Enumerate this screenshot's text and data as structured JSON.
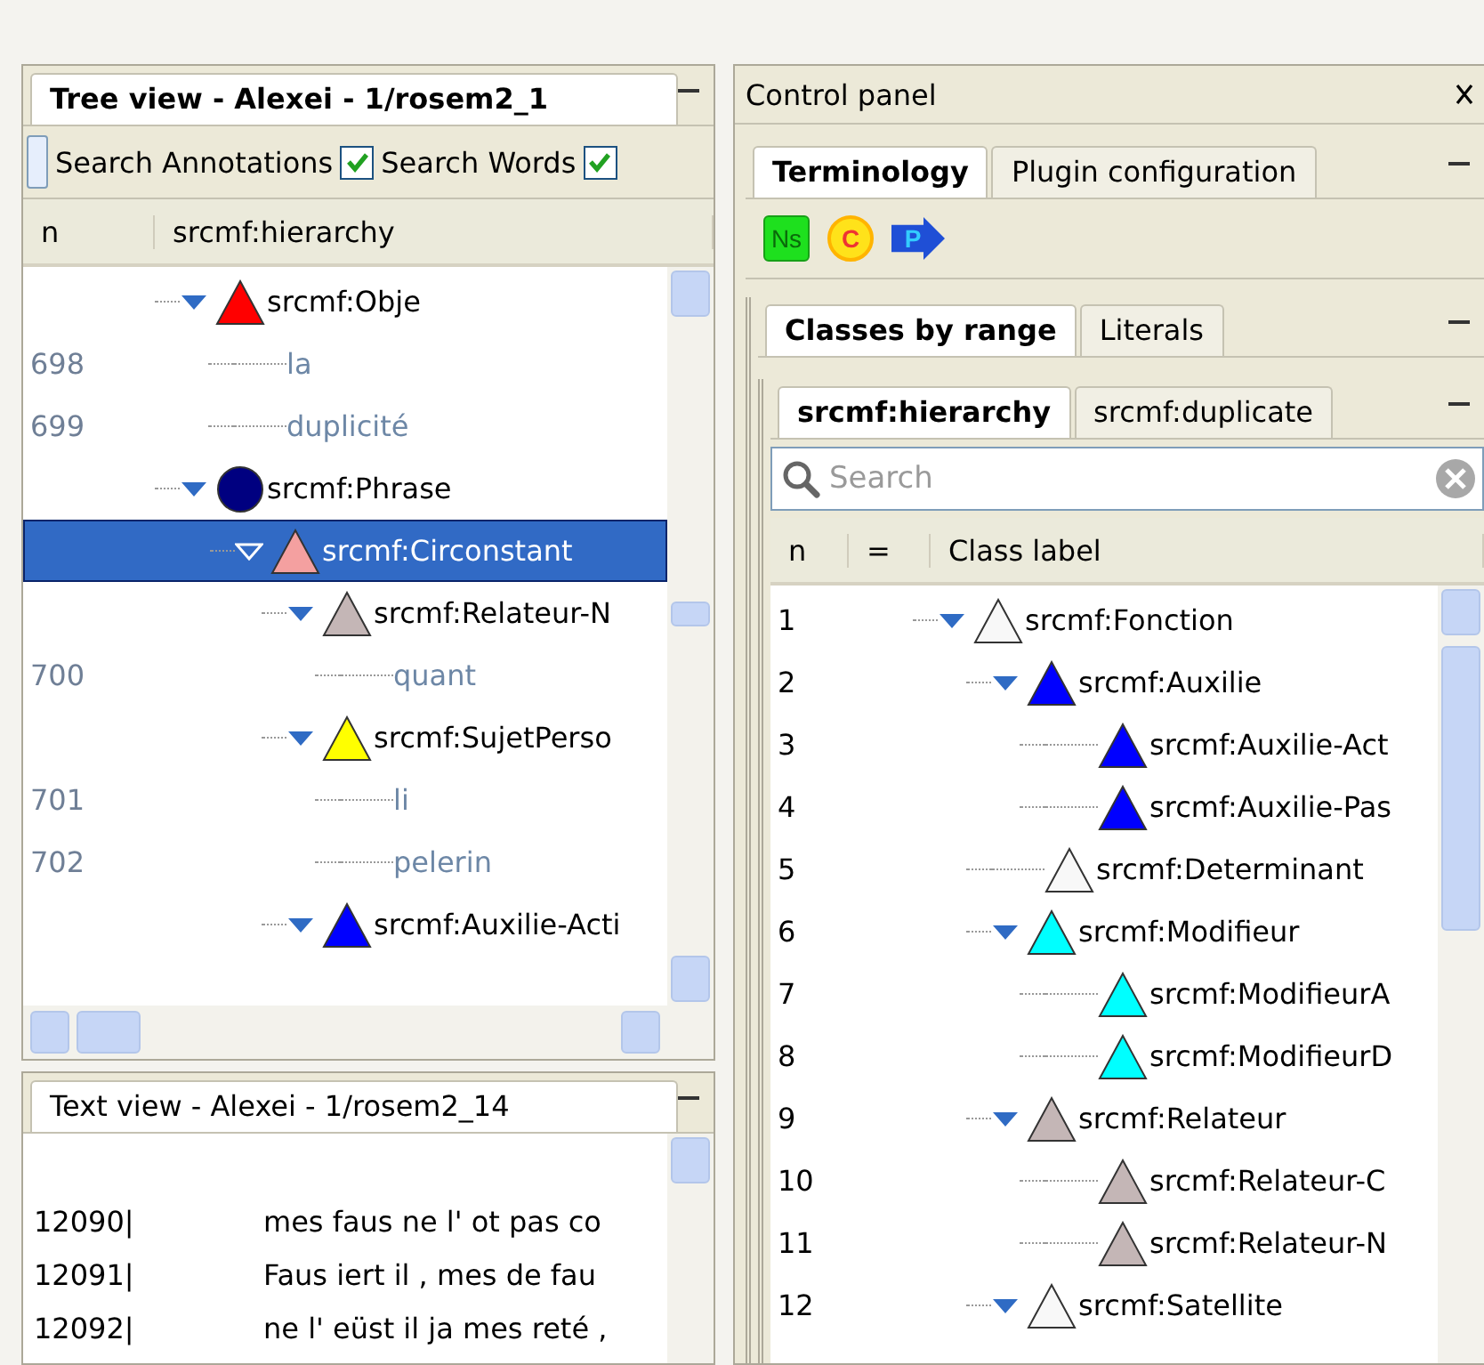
{
  "tree_view": {
    "title": "Tree view - Alexei - 1/rosem2_1",
    "toolbar": [
      {
        "label": "Search Annotations",
        "checked": true
      },
      {
        "label": "Search Words",
        "checked": true
      }
    ],
    "columns": [
      "n",
      "srcmf:hierarchy"
    ],
    "rows": [
      {
        "kind": "triangle",
        "label": "srcmf:Obje",
        "color": "#ff0000",
        "expanded": true,
        "selected": false,
        "children": [
          {
            "kind": "word",
            "n": "698",
            "label": "la",
            "selected": false
          },
          {
            "kind": "word",
            "n": "699",
            "label": "duplicité",
            "selected": false
          }
        ]
      },
      {
        "kind": "circle",
        "label": "srcmf:Phrase",
        "color": "#000080",
        "expanded": true,
        "selected": false,
        "children": [
          {
            "kind": "triangle",
            "label": "srcmf:Circonstant",
            "color": "#f4a0a0",
            "expanded": true,
            "selected": true,
            "children": [
              {
                "kind": "triangle",
                "label": "srcmf:Relateur-N",
                "color": "#c4b6b6",
                "expanded": true,
                "selected": false,
                "children": [
                  {
                    "kind": "word",
                    "n": "700",
                    "label": "quant",
                    "selected": false
                  }
                ]
              },
              {
                "kind": "triangle",
                "label": "srcmf:SujetPerso",
                "color": "#ffff00",
                "expanded": true,
                "selected": false,
                "children": [
                  {
                    "kind": "word",
                    "n": "701",
                    "label": "li",
                    "selected": false
                  },
                  {
                    "kind": "word",
                    "n": "702",
                    "label": "pelerin",
                    "selected": false
                  }
                ]
              },
              {
                "kind": "triangle",
                "label": "srcmf:Auxilie-Acti",
                "color": "#0000ff",
                "expanded": true,
                "selected": false
              }
            ]
          }
        ]
      }
    ]
  },
  "text_view": {
    "title": "Text view - Alexei - 1/rosem2_14",
    "lines": [
      {
        "n": "12090|",
        "text": "mes faus ne l' ot pas co"
      },
      {
        "n": "12091|",
        "text": "Faus iert il , mes de fau"
      },
      {
        "n": "12092|",
        "text": "ne l' eüst il ja mes reté ,"
      }
    ]
  },
  "control_panel": {
    "title": "Control panel",
    "tabs": [
      {
        "label": "Terminology",
        "selected": true
      },
      {
        "label": "Plugin configuration",
        "selected": false
      }
    ],
    "toolbar_icons": [
      {
        "kind": "square",
        "label": "Ns"
      },
      {
        "kind": "circle",
        "label": "C"
      },
      {
        "kind": "arrow",
        "label": "P"
      }
    ],
    "view_tabs": [
      {
        "label": "Classes by range",
        "selected": true
      },
      {
        "label": "Literals",
        "selected": false
      }
    ],
    "property_tabs": [
      {
        "label": "srcmf:hierarchy",
        "selected": true
      },
      {
        "label": "srcmf:duplicate",
        "selected": false
      }
    ],
    "search": {
      "placeholder": "Search"
    },
    "columns": [
      "n",
      "=",
      "Class label"
    ],
    "classes": [
      {
        "n": "1",
        "label": "srcmf:Fonction",
        "color": "#f8f8f8",
        "expanded": true,
        "selected": false,
        "children": [
          {
            "n": "2",
            "label": "srcmf:Auxilie",
            "color": "#0000ff",
            "expanded": true,
            "selected": false,
            "children": [
              {
                "n": "3",
                "label": "srcmf:Auxilie-Act",
                "color": "#0000ff",
                "selected": false
              },
              {
                "n": "4",
                "label": "srcmf:Auxilie-Pas",
                "color": "#0000ff",
                "selected": false
              }
            ]
          },
          {
            "n": "5",
            "label": "srcmf:Determinant",
            "color": "#f8f8f8",
            "selected": false
          },
          {
            "n": "6",
            "label": "srcmf:Modifieur",
            "color": "#00ffff",
            "expanded": true,
            "selected": false,
            "children": [
              {
                "n": "7",
                "label": "srcmf:ModifieurA",
                "color": "#00ffff",
                "selected": false
              },
              {
                "n": "8",
                "label": "srcmf:ModifieurD",
                "color": "#00ffff",
                "selected": false
              }
            ]
          },
          {
            "n": "9",
            "label": "srcmf:Relateur",
            "color": "#c4b6b6",
            "expanded": true,
            "selected": false,
            "children": [
              {
                "n": "10",
                "label": "srcmf:Relateur-C",
                "color": "#c4b6b6",
                "selected": false
              },
              {
                "n": "11",
                "label": "srcmf:Relateur-N",
                "color": "#c4b6b6",
                "selected": false
              }
            ]
          },
          {
            "n": "12",
            "label": "srcmf:Satellite",
            "color": "#f8f8f8",
            "expanded": true,
            "selected": false
          }
        ]
      }
    ]
  }
}
